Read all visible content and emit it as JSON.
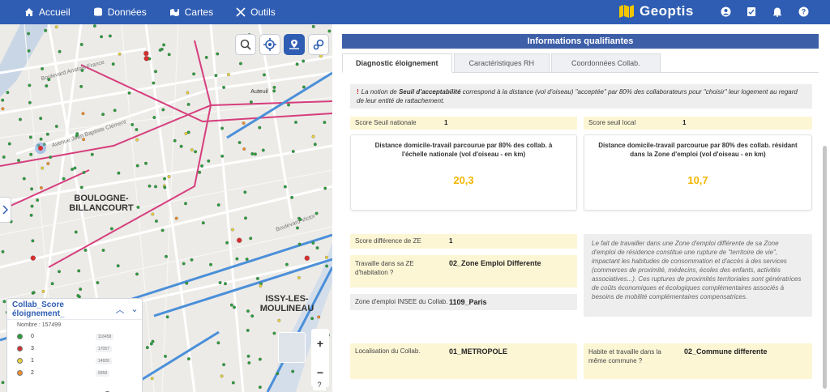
{
  "nav": {
    "items": [
      {
        "label": "Accueil",
        "icon": "home-icon"
      },
      {
        "label": "Données",
        "icon": "database-icon"
      },
      {
        "label": "Cartes",
        "icon": "map-icon"
      },
      {
        "label": "Outils",
        "icon": "tools-icon"
      }
    ],
    "brand": "Geoptis",
    "right_icons": [
      "user-icon",
      "checklist-icon",
      "bell-icon",
      "help-icon"
    ]
  },
  "map": {
    "labels": {
      "boulogne": "BOULOGNE-\nBILLANCOURT",
      "issy": "ISSY-LES-\nMOULINEAU",
      "auteuil": "Auteuil",
      "av_jb_clement": "Avenue Jean Baptiste Clément",
      "bd_anatole": "Boulevard Anatole France",
      "bd_victor": "Boulevard Victor"
    },
    "tools": [
      "search-icon",
      "locate-icon",
      "layers-icon",
      "settings-icon"
    ],
    "zoom_in": "+",
    "zoom_out": "−",
    "help": "?"
  },
  "legend": {
    "title": "Collab_Score éloignement_",
    "subtitle": "Nombre : 157499",
    "rows": [
      {
        "label": "0",
        "count": "116458",
        "color": "#2a9d3b"
      },
      {
        "label": "3",
        "count": "17057",
        "color": "#d62f2f"
      },
      {
        "label": "1",
        "count": "14926",
        "color": "#e8d23a"
      },
      {
        "label": "2",
        "count": "6958",
        "color": "#f28c28"
      }
    ],
    "slider_level": 0.77
  },
  "panel": {
    "header": "Informations qualifiantes",
    "tabs": [
      "Diagnostic éloignement",
      "Caractéristiques RH",
      "Coordonnées Collab."
    ],
    "note_bang": "!",
    "note_pre": "La notion de ",
    "note_bold": "Seuil d'acceptabilité",
    "note_post": " correspond à la distance (vol d'oiseau) \"acceptée\" par 80% des collaborateurs pour \"choisir\" leur logement au regard de leur entité de rattachement.",
    "score_nat_label": "Score Seuil nationale",
    "score_nat_value": "1",
    "score_loc_label": "Score seuil local",
    "score_loc_value": "1",
    "card1_title": "Distance domicile-travail parcourue par 80% des collab. à l'échelle nationale (vol d'oiseau - en km)",
    "card1_value": "20,3",
    "card2_title": "Distance domicile-travail parcourue par 80% des collab. résidant dans la Zone d'emploi (vol d'oiseau - en km)",
    "card2_value": "10,7",
    "ze_score_label": "Score différence de ZE",
    "ze_score_value": "1",
    "ze_work_label": "Travaille dans sa ZE d'habitation ?",
    "ze_work_value": "02_Zone Emploi Differente",
    "ze_insee_label": "Zone d'emploi INSEE du Collab.",
    "ze_insee_value": "1109_Paris",
    "desc": "Le fait de travailler dans une Zone d'emploi différente de sa Zone d'emploi de résidence constitue une rupture de \"territoire de vie\", impactant les habitudes de consommation et d'accès à des services (commerces de proximité, médecins, écoles des enfants, activités associatives...). Ces ruptures de proximités territoriales sont génératrices de coûts économiques et écologiques complémentaires associés à besoins de mobilité complémentaires compensatrices.",
    "loc_label": "Localisation du Collab.",
    "loc_value": "01_METROPOLE",
    "commune_label": "Habite et travaille dans la même commune ?",
    "commune_value": "02_Commune differente"
  },
  "colors": {
    "nav": "#2f5db3",
    "header": "#3d5fa8",
    "highlight_value": "#f2b600",
    "yellow_cell": "#fdf6d5",
    "grey_cell": "#eeeeee"
  }
}
